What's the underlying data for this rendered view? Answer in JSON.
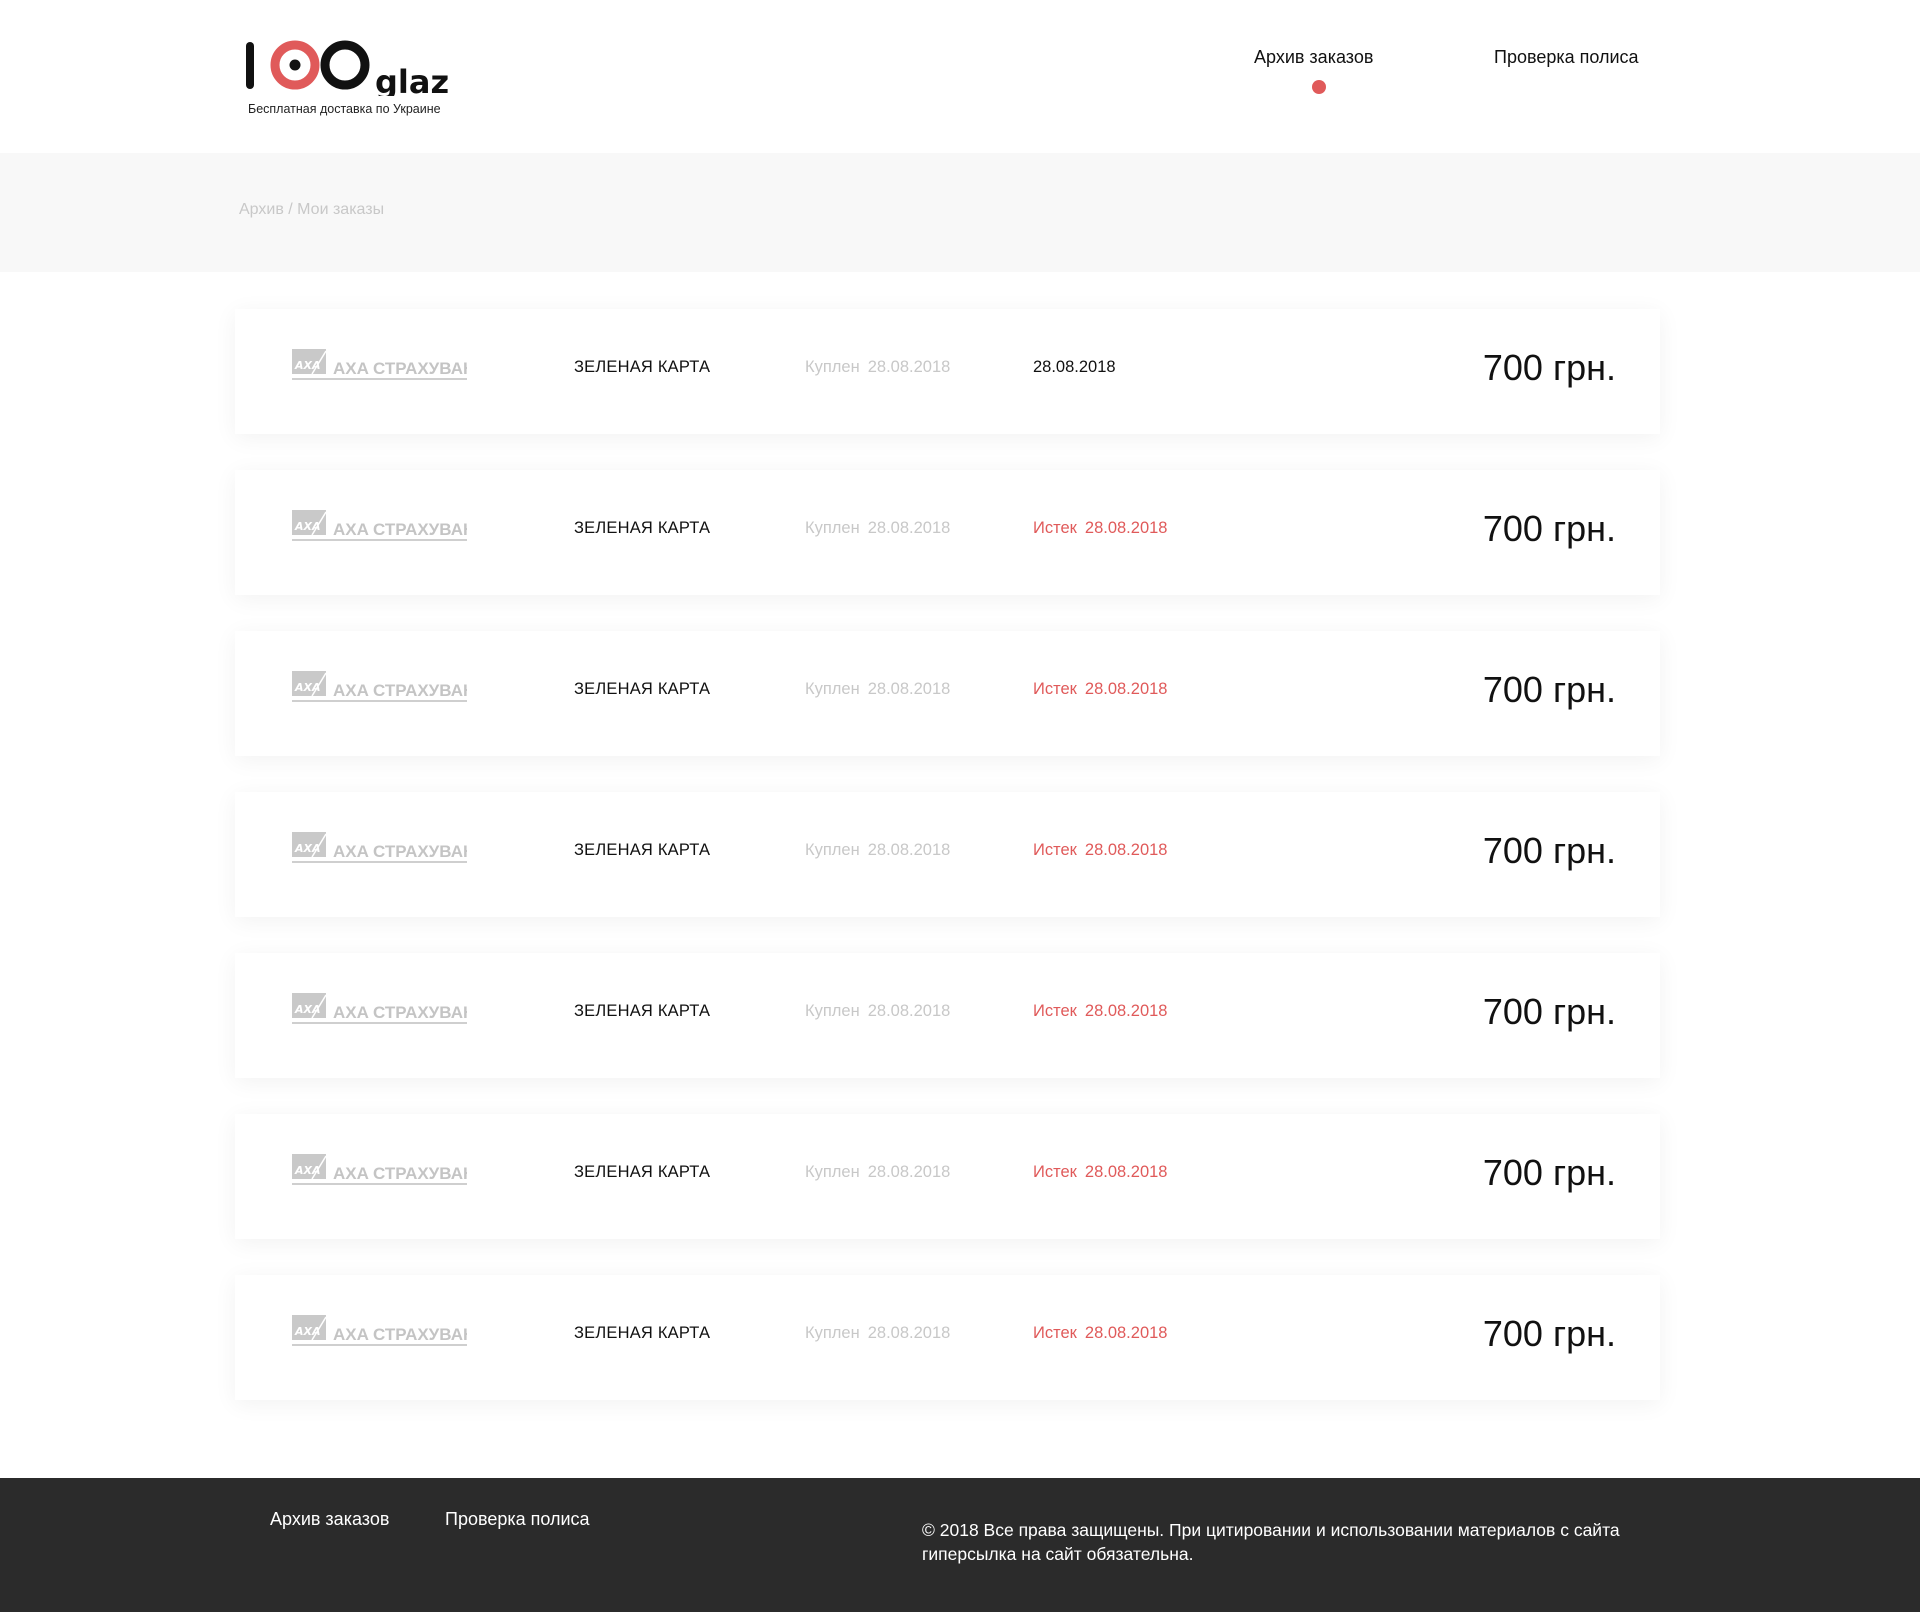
{
  "header": {
    "logo_text": "100glaz",
    "tagline": "Бесплатная доставка по Украине",
    "nav": [
      {
        "label": "Архив заказов",
        "active": true
      },
      {
        "label": "Проверка полиса",
        "active": false
      }
    ]
  },
  "breadcrumb": {
    "text": "Архив / Мои заказы"
  },
  "colors": {
    "accent": "#e05a5a",
    "muted": "#c8c8c8",
    "footer_bg": "#2b2b2b",
    "band_bg": "#f8f8f8"
  },
  "orders": [
    {
      "insurer": "AXA СТРАХУВАННЯ",
      "product": "ЗЕЛЕНАЯ КАРТА",
      "bought_label": "Куплен",
      "bought_date": "28.08.2018",
      "expiry_label": "",
      "expiry_date": "28.08.2018",
      "expired": false,
      "price": "700 грн."
    },
    {
      "insurer": "AXA СТРАХУВАННЯ",
      "product": "ЗЕЛЕНАЯ КАРТА",
      "bought_label": "Куплен",
      "bought_date": "28.08.2018",
      "expiry_label": "Истек",
      "expiry_date": "28.08.2018",
      "expired": true,
      "price": "700 грн."
    },
    {
      "insurer": "AXA СТРАХУВАННЯ",
      "product": "ЗЕЛЕНАЯ КАРТА",
      "bought_label": "Куплен",
      "bought_date": "28.08.2018",
      "expiry_label": "Истек",
      "expiry_date": "28.08.2018",
      "expired": true,
      "price": "700 грн."
    },
    {
      "insurer": "AXA СТРАХУВАННЯ",
      "product": "ЗЕЛЕНАЯ КАРТА",
      "bought_label": "Куплен",
      "bought_date": "28.08.2018",
      "expiry_label": "Истек",
      "expiry_date": "28.08.2018",
      "expired": true,
      "price": "700 грн."
    },
    {
      "insurer": "AXA СТРАХУВАННЯ",
      "product": "ЗЕЛЕНАЯ КАРТА",
      "bought_label": "Куплен",
      "bought_date": "28.08.2018",
      "expiry_label": "Истек",
      "expiry_date": "28.08.2018",
      "expired": true,
      "price": "700 грн."
    },
    {
      "insurer": "AXA СТРАХУВАННЯ",
      "product": "ЗЕЛЕНАЯ КАРТА",
      "bought_label": "Куплен",
      "bought_date": "28.08.2018",
      "expiry_label": "Истек",
      "expiry_date": "28.08.2018",
      "expired": true,
      "price": "700 грн."
    },
    {
      "insurer": "AXA СТРАХУВАННЯ",
      "product": "ЗЕЛЕНАЯ КАРТА",
      "bought_label": "Куплен",
      "bought_date": "28.08.2018",
      "expiry_label": "Истек",
      "expiry_date": "28.08.2018",
      "expired": true,
      "price": "700 грн."
    }
  ],
  "footer": {
    "links": [
      "Архив заказов",
      "Проверка полиса"
    ],
    "copyright": "©  2018 Все права защищены. При цитировании и использовании материалов с сайта гиперсылка на сайт обязательна."
  }
}
